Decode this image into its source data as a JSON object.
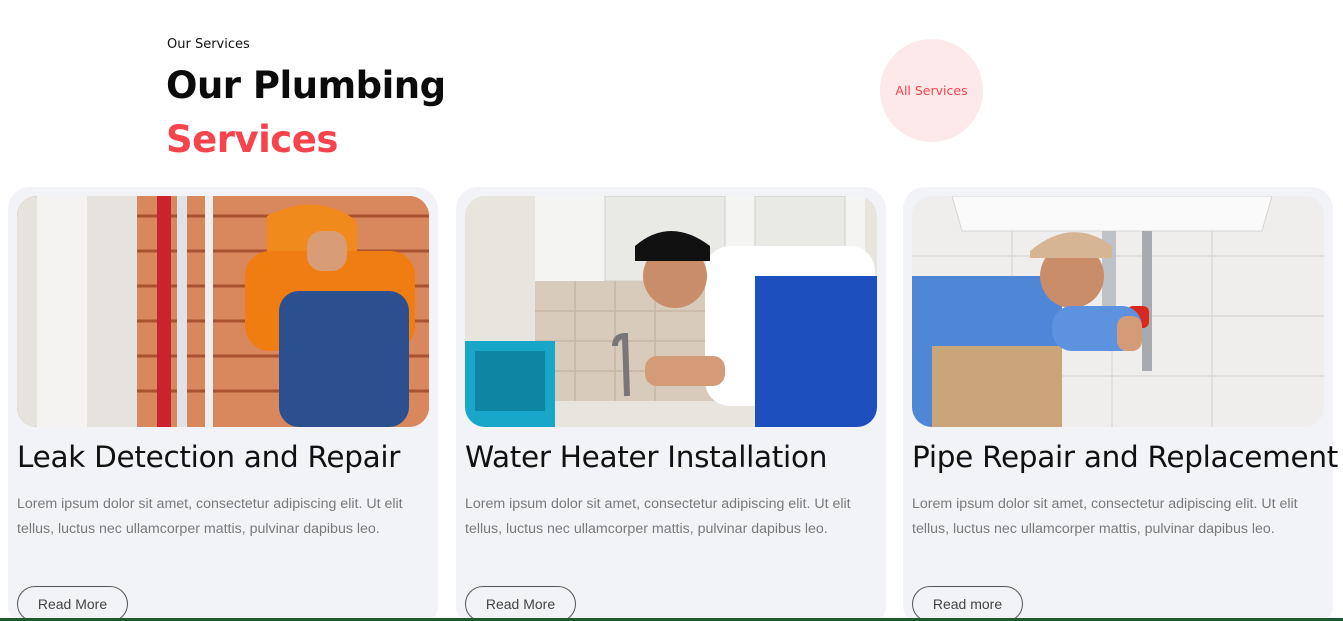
{
  "colors": {
    "accent": "#f7434c",
    "card_bg": "#f2f3f6",
    "pill_bg": "#fde9ea"
  },
  "header": {
    "eyebrow": "Our Services",
    "title_line1": "Our Plumbing",
    "title_line2": "Services",
    "all_services_label": "All Services"
  },
  "cards": [
    {
      "title": "Leak Detection and Repair",
      "text": "Lorem ipsum dolor sit amet, consectetur adipiscing elit. Ut elit tellus, luctus nec ullamcorper mattis, pulvinar dapibus leo.",
      "button": "Read More",
      "image_icon": "plumber-leak-photo"
    },
    {
      "title": "Water Heater Installation",
      "text": "Lorem ipsum dolor sit amet, consectetur adipiscing elit. Ut elit tellus, luctus nec ullamcorper mattis, pulvinar dapibus leo.",
      "button": "Read More",
      "image_icon": "plumber-kitchen-photo"
    },
    {
      "title": "Pipe Repair and Replacement",
      "text": "Lorem ipsum dolor sit amet, consectetur adipiscing elit. Ut elit tellus, luctus nec ullamcorper mattis, pulvinar dapibus leo.",
      "button": "Read more",
      "image_icon": "plumber-sink-photo"
    }
  ]
}
